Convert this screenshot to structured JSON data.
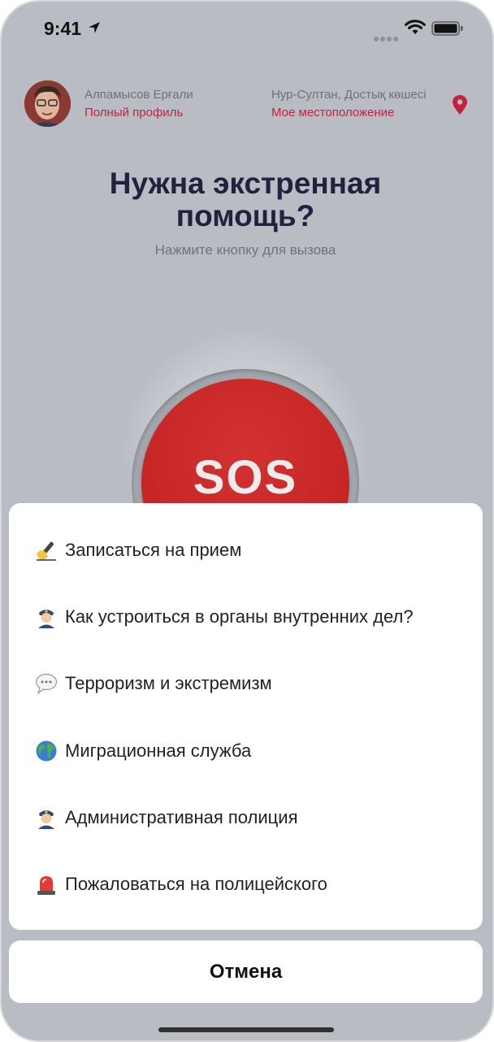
{
  "status_bar": {
    "time": "9:41"
  },
  "profile": {
    "name": "Алпамысов Ерғали",
    "profile_link": "Полный профиль"
  },
  "location": {
    "address": "Нур-Султан, Достық көшесі",
    "link": "Мое местоположение"
  },
  "main": {
    "title_line1": "Нужна экстренная",
    "title_line2": "помощь?",
    "subtitle": "Нажмите кнопку для вызова",
    "sos_label": "SOS"
  },
  "action_sheet": {
    "items": [
      {
        "icon": "writing-hand-icon",
        "label": "Записаться на прием"
      },
      {
        "icon": "police-officer-icon",
        "label": "Как устроиться в органы внутренних дел?"
      },
      {
        "icon": "speech-bubble-icon",
        "label": "Терроризм и экстремизм"
      },
      {
        "icon": "globe-icon",
        "label": "Миграционная служба"
      },
      {
        "icon": "police-officer-icon",
        "label": "Административная полиция"
      },
      {
        "icon": "police-light-icon",
        "label": "Пожаловаться на полицейского"
      }
    ],
    "cancel_label": "Отмена"
  },
  "colors": {
    "accent": "#c4213f",
    "sos_red": "#c62626",
    "title": "#1f2340",
    "background": "#b9bcc3"
  }
}
